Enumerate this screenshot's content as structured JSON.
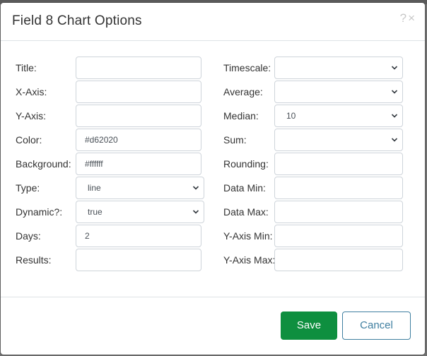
{
  "dialog": {
    "title": "Field 8 Chart Options",
    "help_glyph": "?",
    "close_glyph": "×"
  },
  "left_fields": [
    {
      "label": "Title:",
      "value": "",
      "kind": "input"
    },
    {
      "label": "X-Axis:",
      "value": "",
      "kind": "input"
    },
    {
      "label": "Y-Axis:",
      "value": "",
      "kind": "input"
    },
    {
      "label": "Color:",
      "value": "#d62020",
      "kind": "input"
    },
    {
      "label": "Background:",
      "value": "#ffffff",
      "kind": "input"
    },
    {
      "label": "Type:",
      "value": "line",
      "kind": "select"
    },
    {
      "label": "Dynamic?:",
      "value": "true",
      "kind": "select"
    },
    {
      "label": "Days:",
      "value": "2",
      "kind": "input"
    },
    {
      "label": "Results:",
      "value": "",
      "kind": "input"
    }
  ],
  "right_fields": [
    {
      "label": "Timescale:",
      "value": "",
      "kind": "select"
    },
    {
      "label": "Average:",
      "value": "",
      "kind": "select"
    },
    {
      "label": "Median:",
      "value": "10",
      "kind": "select"
    },
    {
      "label": "Sum:",
      "value": "",
      "kind": "select"
    },
    {
      "label": "Rounding:",
      "value": "",
      "kind": "input"
    },
    {
      "label": "Data Min:",
      "value": "",
      "kind": "input"
    },
    {
      "label": "Data Max:",
      "value": "",
      "kind": "input"
    },
    {
      "label": "Y-Axis Min:",
      "value": "",
      "kind": "input"
    },
    {
      "label": "Y-Axis Max:",
      "value": "",
      "kind": "input"
    }
  ],
  "footer": {
    "save_label": "Save",
    "cancel_label": "Cancel"
  },
  "colors": {
    "save_bg": "#0e8f3f",
    "cancel_border": "#3f7fa0"
  }
}
